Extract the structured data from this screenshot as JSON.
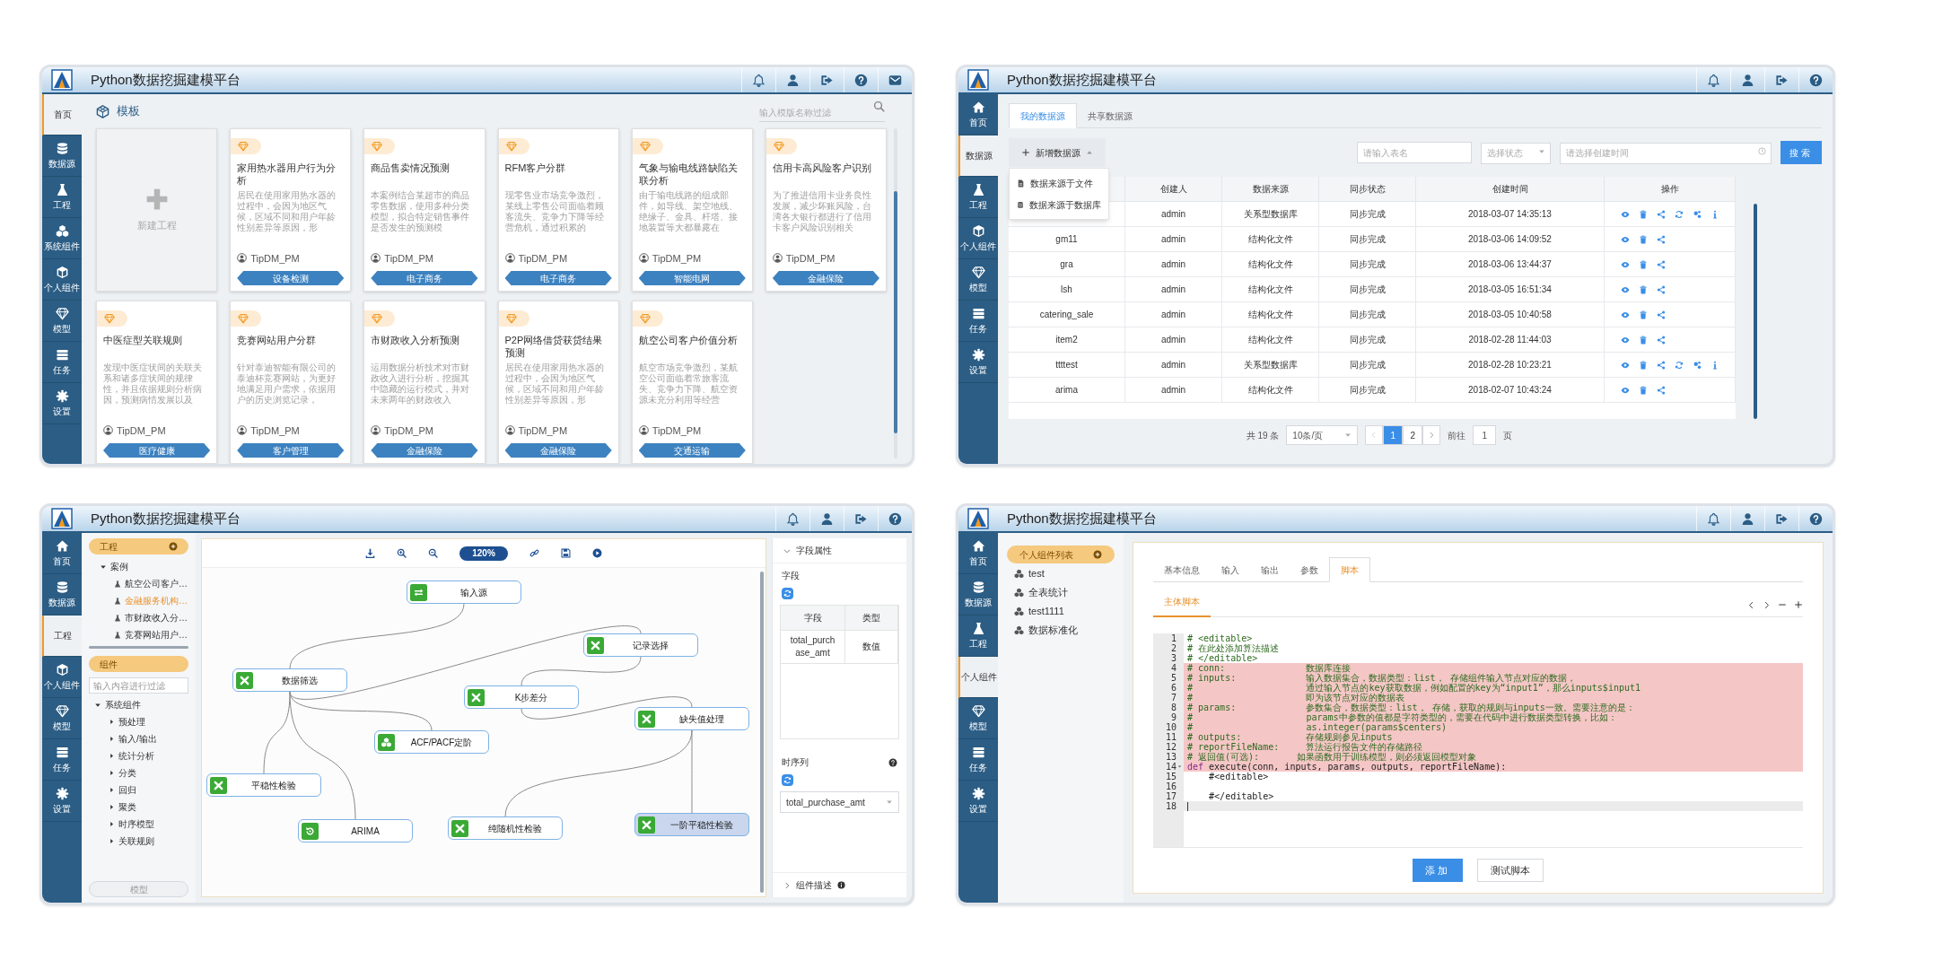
{
  "panels": [
    {
      "kind": "templates",
      "title": "Python数据挖掘建模平台",
      "mail": true,
      "sidebar": [
        {
          "kind": "home",
          "label": "首页",
          "selected": true
        },
        {
          "kind": "database",
          "label": "数据源",
          "selected": false
        },
        {
          "kind": "flask",
          "label": "工程",
          "selected": false
        },
        {
          "kind": "cubes",
          "label": "系统组件",
          "selected": false
        },
        {
          "kind": "cube",
          "label": "个人组件",
          "selected": false
        },
        {
          "kind": "diamond",
          "label": "模型",
          "selected": false
        },
        {
          "kind": "tasks",
          "label": "任务",
          "selected": false
        },
        {
          "kind": "gear",
          "label": "设置",
          "selected": false
        }
      ],
      "heading": "模板",
      "search": {
        "placeholder": "输入模版名称过滤"
      },
      "new_card": "新建工程",
      "cards": [
        {
          "title": "家用热水器用户行为分析",
          "description": "居民在使用家用热水器的过程中，会因为地区气候，区域不同和用户年龄性别差异等原因，形",
          "author": "TipDM_PM",
          "tag": "设备检测"
        },
        {
          "title": "商品售卖情况预测",
          "description": "本案例结合某超市的商品零售数据，使用多种分类模型，拟合特定销售事件是否发生的预测模",
          "author": "TipDM_PM",
          "tag": "电子商务"
        },
        {
          "title": "RFM客户分群",
          "description": "现零售业市场竞争激烈，某线上零售公司面临着顾客流失、竞争力下降等经营危机，通过积累的",
          "author": "TipDM_PM",
          "tag": "电子商务"
        },
        {
          "title": "气象与输电线路缺陷关联分析",
          "description": "由于输电线路的组成部件，如导线、架空地线、绝缘子、金具、杆塔、接地装置等大都暴露在",
          "author": "TipDM_PM",
          "tag": "智能电网"
        },
        {
          "title": "信用卡高风险客户识别",
          "description": "为了推进信用卡业务良性发展，减少坏账风险，台湾各大银行都进行了信用卡客户风险识别相关",
          "author": "TipDM_PM",
          "tag": "金融保险"
        },
        {
          "title": "中医症型关联规则",
          "description": "发现中医症状间的关联关系和诸多症状间的规律性，并且依据规则分析病因，预测病情发展以及",
          "author": "TipDM_PM",
          "tag": "医疗健康"
        },
        {
          "title": "竞赛网站用户分群",
          "description": "针对泰迪智能有限公司的泰迪杯竞赛网站，为更好地满足用户需求，依据用户的历史浏览记录，",
          "author": "TipDM_PM",
          "tag": "客户管理"
        },
        {
          "title": "市财政收入分析预测",
          "description": "运用数据分析技术对市财政收入进行分析，挖掘其中隐藏的运行模式，并对未来两年的财政收入",
          "author": "TipDM_PM",
          "tag": "金融保险"
        },
        {
          "title": "P2P网络借贷获贷结果预测",
          "description": "居民在使用家用热水器的过程中，会因为地区气候，区域不同和用户年龄性别差异等原因，形",
          "author": "TipDM_PM",
          "tag": "金融保险"
        },
        {
          "title": "航空公司客户价值分析",
          "description": "航空市场竞争激烈，某航空公司面临着常旅客流失、竞争力下降、航空资源未充分利用等经营",
          "author": "TipDM_PM",
          "tag": "交通运输"
        }
      ]
    },
    {
      "kind": "datasources",
      "title": "Python数据挖掘建模平台",
      "sidebar": [
        {
          "kind": "home",
          "label": "首页",
          "selected": false
        },
        {
          "kind": "database",
          "label": "数据源",
          "selected": true
        },
        {
          "kind": "flask",
          "label": "工程",
          "selected": false
        },
        {
          "kind": "cube",
          "label": "个人组件",
          "selected": false
        },
        {
          "kind": "diamond",
          "label": "模型",
          "selected": false
        },
        {
          "kind": "tasks",
          "label": "任务",
          "selected": false
        },
        {
          "kind": "gear",
          "label": "设置",
          "selected": false
        }
      ],
      "tabs": [
        {
          "label": "我的数据源",
          "selected": true
        },
        {
          "label": "共享数据源",
          "selected": false
        }
      ],
      "add_button": "新增数据源",
      "menu": [
        {
          "kind": "file",
          "label": "数据来源于文件"
        },
        {
          "kind": "database",
          "label": "数据来源于数据库"
        }
      ],
      "filters": {
        "name": {
          "placeholder": "请输入表名"
        },
        "status": {
          "placeholder": "选择状态"
        },
        "date": {
          "placeholder": "请选择创建时间"
        }
      },
      "search_button": "搜索",
      "table": {
        "columns": [
          "创建人",
          "数据来源",
          "同步状态",
          "创建时间",
          "操作"
        ],
        "rows": [
          {
            "creator": "admin",
            "source": "关系型数据库",
            "status": "同步完成",
            "created": "2018-03-07 14:35:13",
            "extra_actions": true
          },
          {
            "name": "gm11",
            "creator": "admin",
            "source": "结构化文件",
            "status": "同步完成",
            "created": "2018-03-06 14:09:52",
            "extra_actions": false
          },
          {
            "name": "gra",
            "creator": "admin",
            "source": "结构化文件",
            "status": "同步完成",
            "created": "2018-03-06 13:44:37",
            "extra_actions": false
          },
          {
            "name": "lsh",
            "creator": "admin",
            "source": "结构化文件",
            "status": "同步完成",
            "created": "2018-03-05 16:51:34",
            "extra_actions": false
          },
          {
            "name": "catering_sale",
            "creator": "admin",
            "source": "结构化文件",
            "status": "同步完成",
            "created": "2018-03-05 10:40:58",
            "extra_actions": false
          },
          {
            "name": "item2",
            "creator": "admin",
            "source": "结构化文件",
            "status": "同步完成",
            "created": "2018-02-28 11:44:03",
            "extra_actions": false
          },
          {
            "name": "ttttest",
            "creator": "admin",
            "source": "关系型数据库",
            "status": "同步完成",
            "created": "2018-02-28 10:23:21",
            "extra_actions": true
          },
          {
            "name": "arima",
            "creator": "admin",
            "source": "结构化文件",
            "status": "同步完成",
            "created": "2018-02-07 10:43:24",
            "extra_actions": false
          }
        ]
      },
      "pagination": {
        "total": "共 19 条",
        "page_size": "10条/页",
        "pages": [
          {
            "label": "1",
            "selected": true
          },
          {
            "label": "2",
            "selected": false
          }
        ],
        "goto_label": "前往",
        "goto_value": "1",
        "suffix": "页"
      }
    },
    {
      "kind": "workflow",
      "title": "Python数据挖掘建模平台",
      "sidebar": [
        {
          "kind": "home",
          "label": "首页",
          "selected": false
        },
        {
          "kind": "database",
          "label": "数据源",
          "selected": false
        },
        {
          "kind": "flask",
          "label": "工程",
          "selected": true
        },
        {
          "kind": "cube",
          "label": "个人组件",
          "selected": false
        },
        {
          "kind": "diamond",
          "label": "模型",
          "selected": false
        },
        {
          "kind": "tasks",
          "label": "任务",
          "selected": false
        },
        {
          "kind": "gear",
          "label": "设置",
          "selected": false
        }
      ],
      "project_panel": {
        "title": "工程",
        "tree": [
          {
            "label": "案例",
            "expanded": true,
            "children": [
              {
                "label": "航空公司客户…",
                "selected": false
              },
              {
                "label": "金融服务机构…",
                "selected": true
              },
              {
                "label": "市财政收入分…",
                "selected": false
              },
              {
                "label": "竞赛网站用户…",
                "selected": false
              }
            ]
          }
        ]
      },
      "component_panel": {
        "title": "组件",
        "filter": {
          "placeholder": "输入内容进行过滤"
        },
        "tree": [
          {
            "label": "系统组件",
            "expanded": true,
            "children": [
              {
                "label": "预处理",
                "expanded": false
              },
              {
                "label": "输入/输出",
                "expanded": false
              },
              {
                "label": "统计分析",
                "expanded": false
              },
              {
                "label": "分类",
                "expanded": false
              },
              {
                "label": "回归",
                "expanded": false
              },
              {
                "label": "聚类",
                "expanded": false
              },
              {
                "label": "时序模型",
                "expanded": false
              },
              {
                "label": "关联规则",
                "expanded": false
              }
            ]
          }
        ]
      },
      "model_button": "模型",
      "toolbar": {
        "zoom": "120%"
      },
      "nodes": [
        {
          "kind": "transfer",
          "label": "输入源",
          "selected": false
        },
        {
          "kind": "component",
          "label": "记录选择",
          "selected": false
        },
        {
          "kind": "component",
          "label": "数据筛选",
          "selected": false
        },
        {
          "kind": "component",
          "label": "K步差分",
          "selected": false
        },
        {
          "kind": "component",
          "label": "缺失值处理",
          "selected": false
        },
        {
          "kind": "cluster",
          "label": "ACF/PACF定阶",
          "selected": false
        },
        {
          "kind": "component",
          "label": "平稳性检验",
          "selected": false
        },
        {
          "kind": "cycle",
          "label": "ARIMA",
          "selected": false
        },
        {
          "kind": "component",
          "label": "纯随机性检验",
          "selected": false
        },
        {
          "kind": "component",
          "label": "一阶平稳性检验",
          "selected": true
        }
      ],
      "properties": {
        "title": "字段属性",
        "expanded": true,
        "field_label": "字段",
        "columns": [
          "字段",
          "类型"
        ],
        "rows": [
          [
            "total_purchase_amt",
            "数值"
          ]
        ],
        "series_label": "时序列",
        "series_value": "total_purchase_amt",
        "description_title": "组件描述",
        "description_expanded": false
      }
    },
    {
      "kind": "script",
      "title": "Python数据挖掘建模平台",
      "sidebar": [
        {
          "kind": "home",
          "label": "首页",
          "selected": false
        },
        {
          "kind": "database",
          "label": "数据源",
          "selected": false
        },
        {
          "kind": "flask",
          "label": "工程",
          "selected": false
        },
        {
          "kind": "cube",
          "label": "个人组件",
          "selected": true
        },
        {
          "kind": "diamond",
          "label": "模型",
          "selected": false
        },
        {
          "kind": "tasks",
          "label": "任务",
          "selected": false
        },
        {
          "kind": "gear",
          "label": "设置",
          "selected": false
        }
      ],
      "list_title": "个人组件列表",
      "components": [
        "test",
        "全表统计",
        "test1111",
        "数据标准化"
      ],
      "tabs": [
        {
          "label": "基本信息",
          "selected": false
        },
        {
          "label": "输入",
          "selected": false
        },
        {
          "label": "输出",
          "selected": false
        },
        {
          "label": "参数",
          "selected": false
        },
        {
          "label": "脚本",
          "selected": true
        }
      ],
      "subtabs": [
        {
          "label": "主体脚本",
          "selected": true
        }
      ],
      "code": [
        {
          "number": "1",
          "highlighted": false,
          "tokens": [
            {
              "kind": "comment",
              "text": "# <editable>"
            }
          ]
        },
        {
          "number": "2",
          "highlighted": false,
          "tokens": [
            {
              "kind": "comment",
              "text": "# 在此处添加算法描述"
            }
          ]
        },
        {
          "number": "3",
          "highlighted": false,
          "tokens": [
            {
              "kind": "comment",
              "text": "# </editable>"
            }
          ]
        },
        {
          "number": "4",
          "highlighted": true,
          "tokens": [
            {
              "kind": "comment",
              "text": "# conn:               数据库连接"
            }
          ]
        },
        {
          "number": "5",
          "highlighted": true,
          "tokens": [
            {
              "kind": "comment",
              "text": "# inputs:             输入数据集合，数据类型：list， 存储组件输入节点对应的数据，"
            }
          ]
        },
        {
          "number": "6",
          "highlighted": true,
          "tokens": [
            {
              "kind": "comment",
              "text": "#                     通过输入节点的key获取数据，例如配置的key为“input1”，那么inputs$input1"
            }
          ]
        },
        {
          "number": "7",
          "highlighted": true,
          "tokens": [
            {
              "kind": "comment",
              "text": "#                     即为该节点对应的数据表"
            }
          ]
        },
        {
          "number": "8",
          "highlighted": true,
          "tokens": [
            {
              "kind": "comment",
              "text": "# params:             参数集合，数据类型：list， 存储，获取的规则与inputs一致。需要注意的是："
            }
          ]
        },
        {
          "number": "9",
          "highlighted": true,
          "tokens": [
            {
              "kind": "comment",
              "text": "#                     params中参数的值都是字符类型的，需要在代码中进行数据类型转换，比如："
            }
          ]
        },
        {
          "number": "10",
          "highlighted": true,
          "tokens": [
            {
              "kind": "comment",
              "text": "#                     as.integer(params$centers)"
            }
          ]
        },
        {
          "number": "11",
          "highlighted": true,
          "tokens": [
            {
              "kind": "comment",
              "text": "# outputs:            存储规则参见inputs"
            }
          ]
        },
        {
          "number": "12",
          "highlighted": true,
          "tokens": [
            {
              "kind": "comment",
              "text": "# reportFileName:     算法运行报告文件的存储路径"
            }
          ]
        },
        {
          "number": "13",
          "highlighted": true,
          "tokens": [
            {
              "kind": "comment",
              "text": "# 返回值(可选):       如果函数用于训练模型，则必须返回模型对象"
            }
          ]
        },
        {
          "number": "14",
          "highlighted": true,
          "foldable": true,
          "tokens": [
            {
              "kind": "keyword",
              "text": "def"
            },
            {
              "kind": "plain",
              "text": " execute(conn, inputs, params, outputs, reportFileName):"
            }
          ]
        },
        {
          "number": "15",
          "highlighted": false,
          "tokens": [
            {
              "kind": "plain",
              "text": "    #<editable>"
            }
          ]
        },
        {
          "number": "16"
        },
        {
          "number": "17",
          "highlighted": false,
          "tokens": [
            {
              "kind": "plain",
              "text": "    #</editable>"
            }
          ]
        },
        {
          "number": "18",
          "current": true
        }
      ],
      "buttons": [
        {
          "label": "添加",
          "primary": true
        },
        {
          "label": "测试脚本",
          "primary": false
        }
      ]
    }
  ]
}
